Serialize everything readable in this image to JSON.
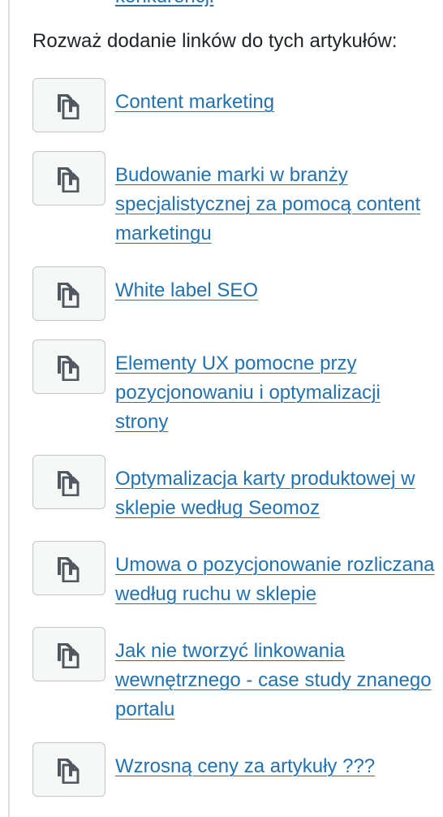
{
  "top_link_text": "konkurencji",
  "intro_text": "Rozważ dodanie linków do tych artykułów:",
  "copy_icon": "copy-icon",
  "colors": {
    "link": "#2271b1",
    "text": "#1d2327",
    "button_bg": "#f6f7f7",
    "button_border": "#c3c4c7",
    "icon": "#50575e"
  },
  "suggestions": [
    {
      "title": "Content marketing"
    },
    {
      "title": "Budowanie marki w branży specjalistycznej za pomocą content marketingu"
    },
    {
      "title": "White label SEO"
    },
    {
      "title": "Elementy UX pomocne przy pozycjonowaniu i optymalizacji strony"
    },
    {
      "title": "Optymalizacja karty produktowej w sklepie według Seomoz"
    },
    {
      "title": "Umowa o pozycjonowanie rozliczana według ruchu w sklepie"
    },
    {
      "title": "Jak nie tworzyć linkowania wewnętrznego - case study znanego portalu"
    },
    {
      "title": "Wzrosną ceny za artykuły ???"
    }
  ]
}
